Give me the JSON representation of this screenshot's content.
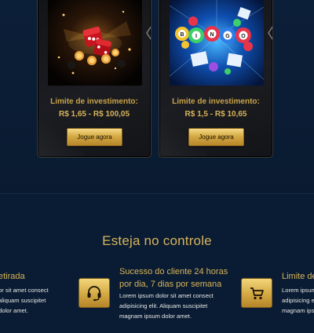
{
  "games": [
    {
      "image": "dice-game-image",
      "limit_label": "Limite de investimento:",
      "limit_range": "R$ 1,65 - R$ 100,05",
      "button_label": "Jogue agora"
    },
    {
      "image": "bingo-game-image",
      "limit_label": "Limite de investimento:",
      "limit_range": "R$ 1,5 - R$ 10,65",
      "button_label": "Jogue agora"
    }
  ],
  "features_section": {
    "title": "Esteja no controle",
    "items": [
      {
        "title": "etirada",
        "text": [
          "or sit amet consect",
          "aliquam suscipitet",
          "dolor amet."
        ]
      },
      {
        "icon": "headset-icon",
        "title": [
          "Sucesso do cliente 24 horas",
          "por dia, 7 dias por semana"
        ],
        "text": [
          "Lorem ipsum dolor sit amet consect",
          "adipisicing elit. Aliquam suscipitet",
          "magnam ipsum dolor amet."
        ]
      },
      {
        "icon": "cart-icon",
        "title": "Limite de",
        "text": [
          "Lorem ipsum",
          "adipisicing e",
          "magnam ipsu"
        ]
      }
    ]
  },
  "colors": {
    "background": "#0a1b31",
    "gold": "#d7b45a",
    "card": "#17191d"
  }
}
